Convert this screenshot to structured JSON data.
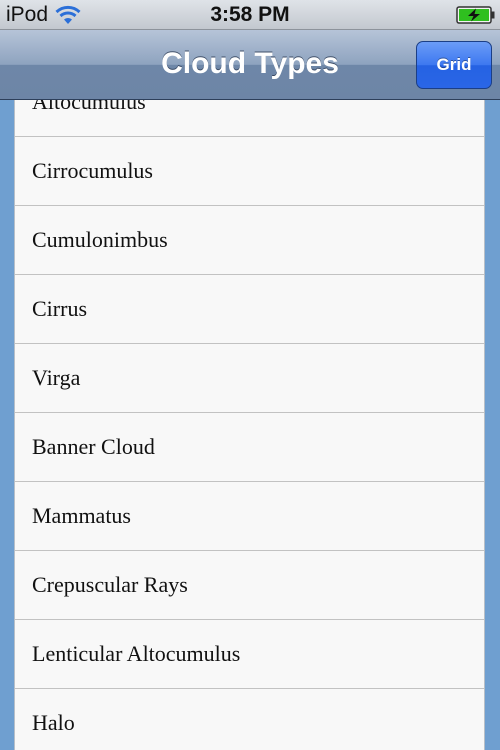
{
  "status_bar": {
    "carrier": "iPod",
    "time": "3:58 PM",
    "icons": [
      "wifi-icon",
      "battery-charging-icon"
    ]
  },
  "nav_bar": {
    "title": "Cloud Types",
    "right_button_label": "Grid"
  },
  "list": {
    "items": [
      "Altocumulus",
      "Cirrocumulus",
      "Cumulonimbus",
      "Cirrus",
      "Virga",
      "Banner Cloud",
      "Mammatus",
      "Crepuscular Rays",
      "Lenticular Altocumulus",
      "Halo"
    ]
  },
  "colors": {
    "background": "#6f9fd0",
    "button_accent": "#2a66e6",
    "battery_green": "#2fbf1f"
  }
}
